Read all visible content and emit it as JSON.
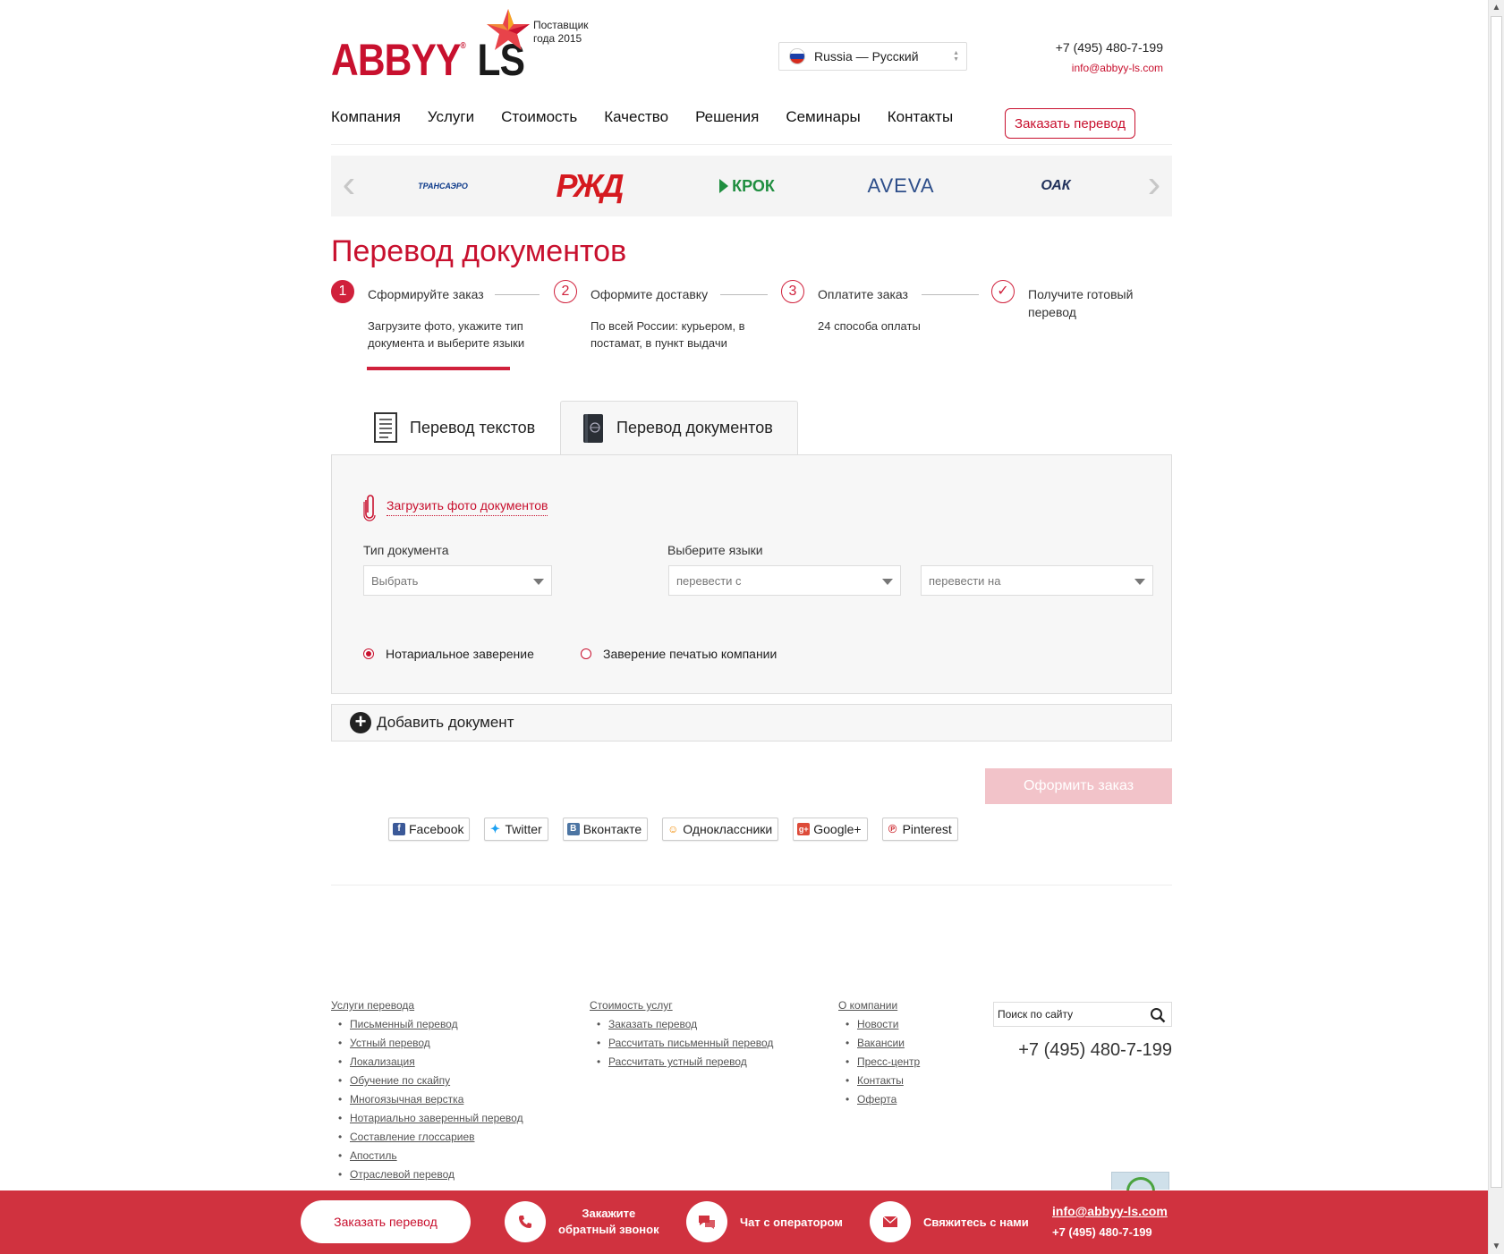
{
  "header": {
    "brand_left": "ABBYY",
    "brand_right": "LS",
    "award": [
      "Поставщик",
      "года 2015"
    ],
    "language": "Russia — Русский",
    "phone": "+7 (495) 480-7-199",
    "email": "info@abbyy-ls.com"
  },
  "nav": {
    "items": [
      "Компания",
      "Услуги",
      "Стоимость",
      "Качество",
      "Решения",
      "Семинары",
      "Контакты"
    ],
    "cta": "Заказать перевод"
  },
  "clients": [
    "ТРАНСАЭРО",
    "РЖД",
    "КРОК",
    "AVEVA",
    "ОАК"
  ],
  "page_title": "Перевод документов",
  "steps": [
    {
      "num": "1",
      "title": "Сформируйте заказ",
      "desc": "Загрузите фото, укажите тип документа и выберите языки"
    },
    {
      "num": "2",
      "title": "Оформите доставку",
      "desc": "По всей России: курьером, в постамат, в пункт выдачи"
    },
    {
      "num": "3",
      "title": "Оплатите заказ",
      "desc": "24 способа оплаты"
    },
    {
      "num": "✓",
      "title": "Получите готовый перевод",
      "desc": ""
    }
  ],
  "tabs": [
    "Перевод текстов",
    "Перевод документов"
  ],
  "form": {
    "upload_label": "Загрузить фото документов",
    "doc_type_label": "Тип документа",
    "doc_type_placeholder": "Выбрать",
    "lang_label": "Выберите языки",
    "lang_from_placeholder": "перевести с",
    "lang_to_placeholder": "перевести на",
    "radio_notary": "Нотариальное заверение",
    "radio_company": "Заверение печатью компании"
  },
  "add_document": "Добавить документ",
  "submit": "Оформить заказ",
  "share": [
    "Facebook",
    "Twitter",
    "Вконтакте",
    "Одноклассники",
    "Google+",
    "Pinterest"
  ],
  "footer": {
    "services": {
      "head": "Услуги перевода",
      "items": [
        "Письменный перевод",
        "Устный перевод",
        "Локализация",
        "Обучение по скайпу",
        "Многоязычная верстка",
        "Нотариально заверенный перевод",
        "Составление глоссариев",
        "Апостиль",
        "Отраслевой перевод"
      ]
    },
    "pricing": {
      "head": "Стоимость услуг",
      "items": [
        "Заказать перевод",
        "Рассчитать письменный перевод",
        "Рассчитать устный перевод"
      ]
    },
    "company": {
      "head": "О компании",
      "items": [
        "Новости",
        "Вакансии",
        "Пресс-центр",
        "Контакты",
        "Оферта"
      ]
    },
    "search_placeholder": "Поиск по сайту",
    "phone": "+7 (495) 480-7-199"
  },
  "bottom_bar": {
    "order": "Заказать перевод",
    "callback_line1": "Закажите",
    "callback_line2": "обратный звонок",
    "chat": "Чат с оператором",
    "contact": "Свяжитесь с нами",
    "email": "info@abbyy-ls.com",
    "phone": "+7 (495) 480-7-199"
  },
  "colors": {
    "brand_red": "#c8102e",
    "bar_red": "#d0323f",
    "button_disabled": "#f2c3c9",
    "panel_bg": "#f7f7f7"
  }
}
